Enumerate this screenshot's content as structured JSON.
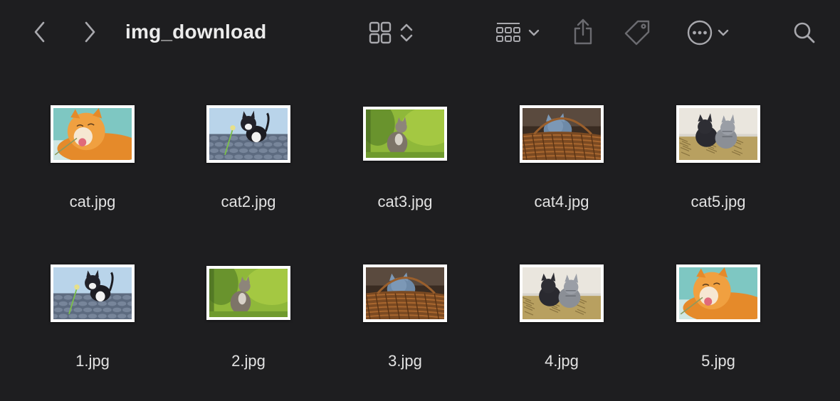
{
  "window": {
    "title": "img_download"
  },
  "toolbar": {
    "icons": [
      "chevron-left-icon",
      "chevron-right-icon",
      "grid-view-icon",
      "sort-updown-icon",
      "group-icon",
      "chevron-down-icon",
      "share-icon",
      "tag-icon",
      "more-ellipsis-icon",
      "chevron-down-icon",
      "search-icon"
    ]
  },
  "files": [
    {
      "name": "cat.jpg",
      "scene": "orange"
    },
    {
      "name": "cat2.jpg",
      "scene": "cobble"
    },
    {
      "name": "cat3.jpg",
      "scene": "grass"
    },
    {
      "name": "cat4.jpg",
      "scene": "basket"
    },
    {
      "name": "cat5.jpg",
      "scene": "hay"
    },
    {
      "name": "1.jpg",
      "scene": "cobble"
    },
    {
      "name": "2.jpg",
      "scene": "grass"
    },
    {
      "name": "3.jpg",
      "scene": "basket"
    },
    {
      "name": "4.jpg",
      "scene": "hay"
    },
    {
      "name": "5.jpg",
      "scene": "orange"
    }
  ],
  "colors": {
    "background": "#1e1e20",
    "icon": "#a8a8ad",
    "icon_dim": "#6b6b70",
    "text": "#e2e2e2"
  }
}
